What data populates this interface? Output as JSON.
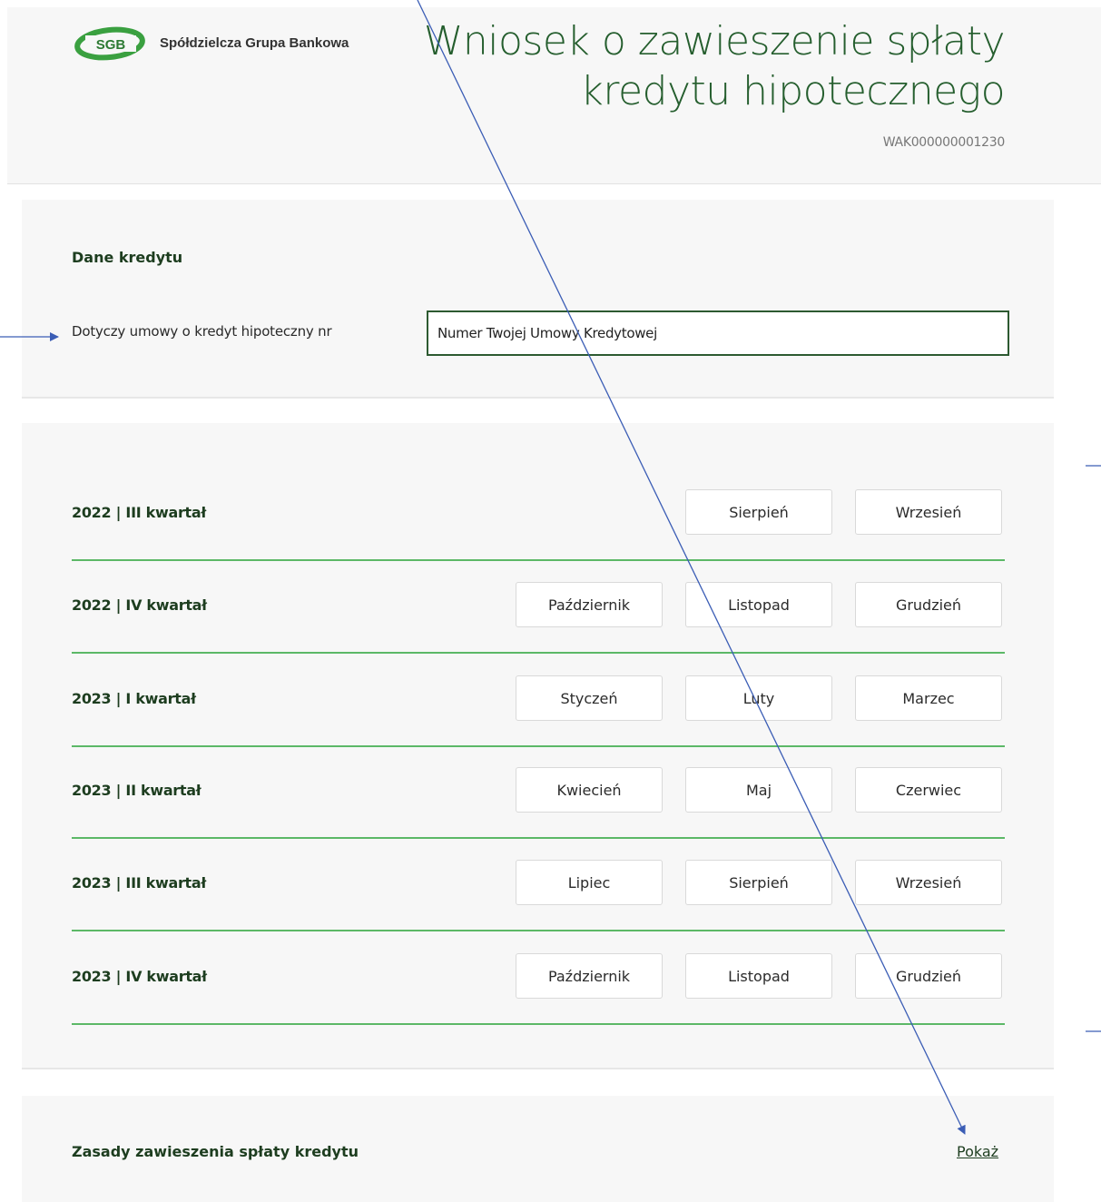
{
  "header": {
    "logo_badge": "SGB",
    "bank_name": "Spółdzielcza Grupa Bankowa",
    "title_line1": "Wniosek o zawieszenie spłaty",
    "title_line2": "kredytu hipotecznego",
    "reference_number": "WAK000000001230"
  },
  "credit_section": {
    "title": "Dane kredytu",
    "field_label": "Dotyczy umowy o kredyt hipoteczny nr",
    "field_value": "Numer Twojej Umowy Kredytowej"
  },
  "quarters": [
    {
      "label": "2022 | III kwartał",
      "months": [
        "Sierpień",
        "Wrzesień"
      ]
    },
    {
      "label": "2022 | IV kwartał",
      "months": [
        "Październik",
        "Listopad",
        "Grudzień"
      ]
    },
    {
      "label": "2023 | I kwartał",
      "months": [
        "Styczeń",
        "Luty",
        "Marzec"
      ]
    },
    {
      "label": "2023 | II kwartał",
      "months": [
        "Kwiecień",
        "Maj",
        "Czerwiec"
      ]
    },
    {
      "label": "2023 | III kwartał",
      "months": [
        "Lipiec",
        "Sierpień",
        "Wrzesień"
      ]
    },
    {
      "label": "2023 | IV kwartał",
      "months": [
        "Październik",
        "Listopad",
        "Grudzień"
      ]
    }
  ],
  "rules_section": {
    "title": "Zasady zawieszenia spłaty kredytu",
    "show_link": "Pokaż"
  },
  "colors": {
    "brand_green": "#2d8f3a",
    "heading_green": "#1d3d1f",
    "title_green": "#255e2e",
    "row_divider": "#5cb867",
    "annotation_blue": "#3b5db5"
  }
}
